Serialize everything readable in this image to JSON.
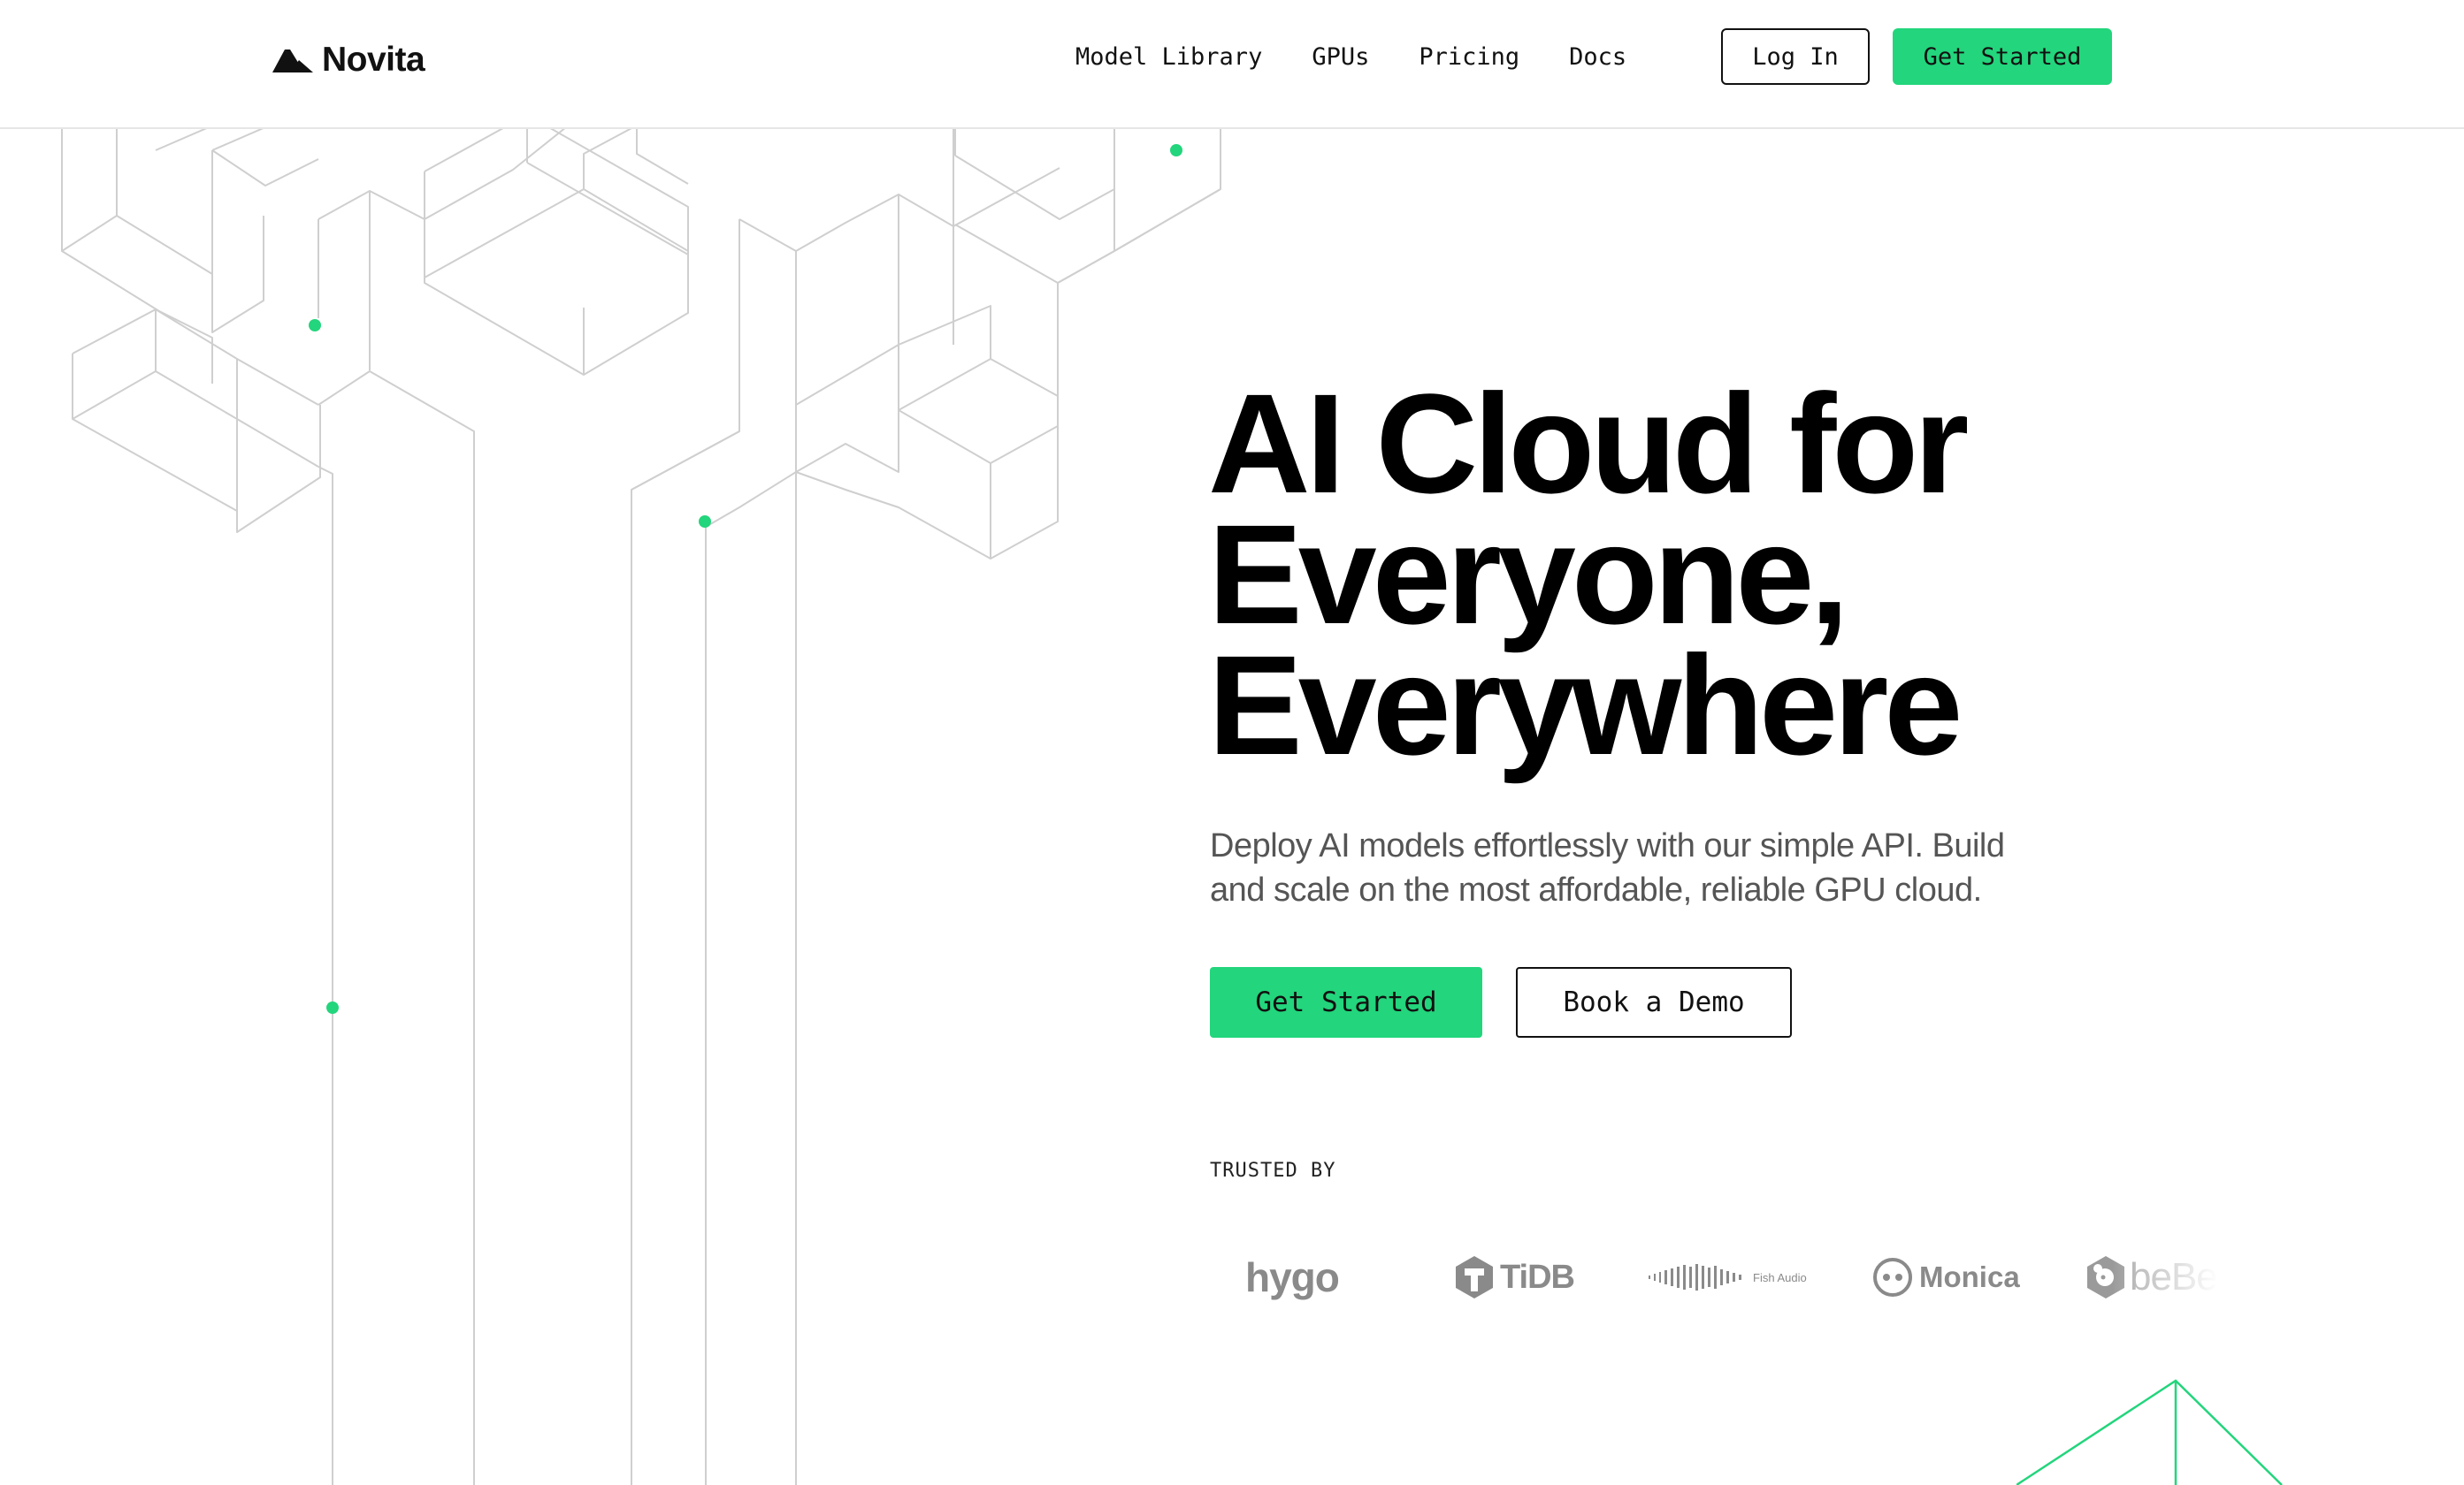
{
  "header": {
    "logo_text": "Novita",
    "nav": [
      {
        "label": "Model Library"
      },
      {
        "label": "GPUs"
      },
      {
        "label": "Pricing"
      },
      {
        "label": "Docs"
      }
    ],
    "login_label": "Log In",
    "get_started_label": "Get Started"
  },
  "hero": {
    "title_lines": [
      "AI Cloud for",
      "Everyone,",
      "Everywhere"
    ],
    "subtitle_lines": [
      "Deploy AI models effortlessly with our simple API. Build",
      "and scale on the most affordable, reliable GPU cloud."
    ],
    "primary_cta": "Get Started",
    "secondary_cta": "Book a Demo"
  },
  "trusted": {
    "label": "TRUSTED BY",
    "brands": [
      {
        "name": "hygo"
      },
      {
        "name": "TiDB"
      },
      {
        "name": "Fish Audio"
      },
      {
        "name": "Monica"
      },
      {
        "name": "beBe"
      }
    ]
  },
  "colors": {
    "accent": "#23d57c",
    "text": "#000000",
    "subtitle": "#555555",
    "line_art": "#cfcfcf",
    "logo_gray": "#8a8a8a"
  },
  "icons": {
    "logo": "novita-mountain-icon"
  }
}
